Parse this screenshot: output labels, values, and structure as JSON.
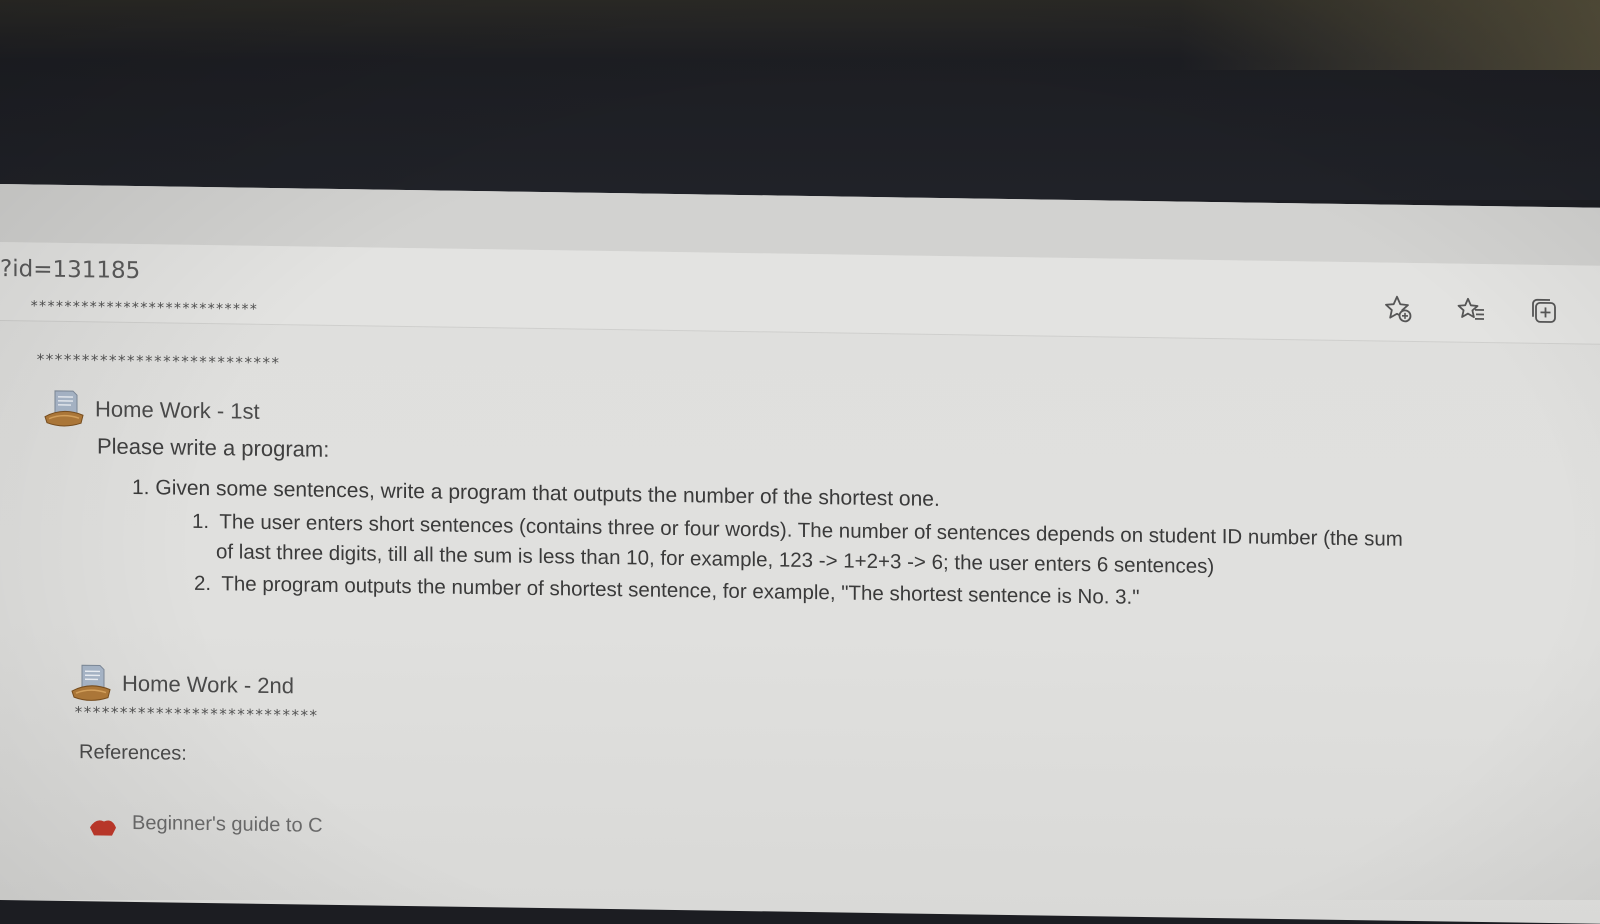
{
  "browser": {
    "url_fragment": "?id=131185",
    "icons": [
      "add-to-favorites-icon",
      "favorites-list-icon",
      "collections-icon"
    ]
  },
  "course": {
    "stars_top": "***************************",
    "stars_section": "***************************",
    "stars_bottom": "***************************",
    "homework_1": {
      "title": "Home Work - 1st",
      "intro": "Please write a program:",
      "items": [
        {
          "num": "1.",
          "text": "Given some sentences, write a program that outputs the number of the shortest one.",
          "subitems": [
            {
              "num": "1.",
              "line1": "The user enters short sentences (contains three or four words). The number of sentences depends on student ID number (the sum",
              "line2": "of last three digits, till all the sum is less than 10, for example, 123 -> 1+2+3 -> 6; the user enters 6 sentences)"
            },
            {
              "num": "2.",
              "line1": "The program outputs the number of shortest sentence, for example, \"The shortest sentence is No. 3.\""
            }
          ]
        }
      ]
    },
    "homework_2": {
      "title": "Home Work - 2nd"
    },
    "references_label": "References:",
    "reference_link_partial": "Beginner's guide to C"
  },
  "colors": {
    "page_bg": "#e0e0de",
    "bezel": "#1d1e23",
    "text": "#3a3a3a"
  }
}
